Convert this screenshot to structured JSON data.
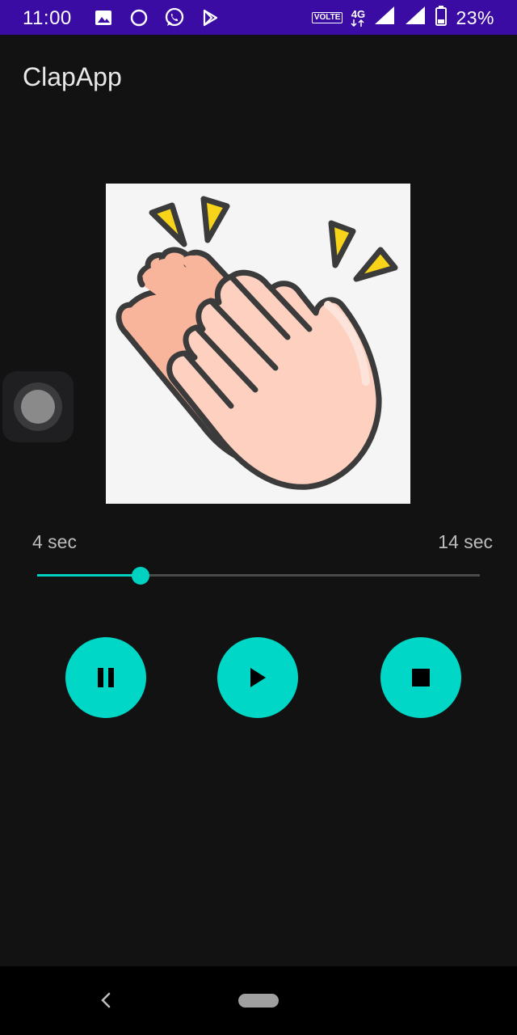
{
  "status_bar": {
    "time": "11:00",
    "network_badge": "VOLTE",
    "network_type": "4G",
    "battery_percent": "23%",
    "left_icons": [
      "image-icon",
      "circle-icon",
      "whatsapp-icon",
      "play-store-icon"
    ],
    "right_icons": [
      "volte-icon",
      "4g-icon",
      "signal-icon",
      "signal-icon",
      "battery-icon"
    ]
  },
  "app_bar": {
    "title": "ClapApp"
  },
  "player": {
    "start_time": "4 sec",
    "end_time": "14 sec",
    "progress_fraction": 0.234,
    "buttons": {
      "pause": "pause-icon",
      "play": "play-icon",
      "stop": "stop-icon"
    }
  },
  "colors": {
    "status_bar": "#3a0ca3",
    "background": "#121212",
    "accent": "#00d7c6",
    "text_primary": "#e8e8e8",
    "text_secondary": "#bdbdbd"
  },
  "navigation": {
    "back_icon": "back-chevron-icon",
    "home_icon": "home-pill-icon"
  }
}
